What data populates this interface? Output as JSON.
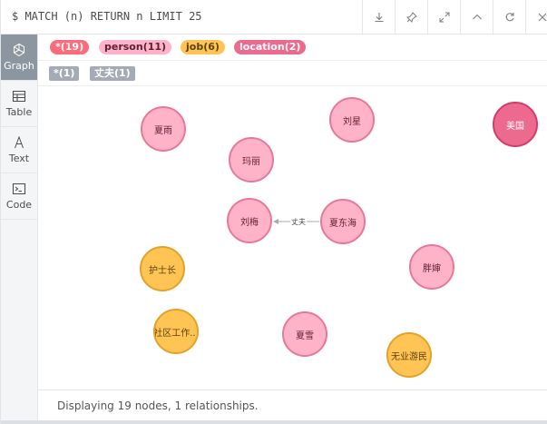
{
  "query": "$ MATCH (n) RETURN n LIMIT 25",
  "toolbar": {
    "icons": [
      "download-icon",
      "pin-icon",
      "expand-icon",
      "collapse-icon",
      "rerun-icon",
      "close-icon"
    ]
  },
  "sidebar": {
    "items": [
      {
        "label": "Graph",
        "icon": "graph-icon",
        "active": true
      },
      {
        "label": "Table",
        "icon": "table-icon",
        "active": false
      },
      {
        "label": "Text",
        "icon": "text-icon",
        "active": false
      },
      {
        "label": "Code",
        "icon": "code-icon",
        "active": false
      }
    ]
  },
  "legend": {
    "labels": [
      {
        "text": "*(19)",
        "color": "#ff6b7a",
        "text_color": "#ffffff"
      },
      {
        "text": "person(11)",
        "color": "#ffb3c8",
        "text_color": "#5f2034"
      },
      {
        "text": "job(6)",
        "color": "#ffc454",
        "text_color": "#5e4210"
      },
      {
        "text": "location(2)",
        "color": "#ed6a8f",
        "text_color": "#ffffff"
      }
    ],
    "relationships": [
      {
        "text": "*(1)"
      },
      {
        "text": "丈夫(1)"
      }
    ]
  },
  "graph": {
    "nodes": [
      {
        "name": "夏雨",
        "type": "person"
      },
      {
        "name": "刘星",
        "type": "person"
      },
      {
        "name": "美国",
        "type": "location"
      },
      {
        "name": "玛丽",
        "type": "person"
      },
      {
        "name": "刘梅",
        "type": "person"
      },
      {
        "name": "夏东海",
        "type": "person"
      },
      {
        "name": "护士长",
        "type": "job"
      },
      {
        "name": "胖婶",
        "type": "person"
      },
      {
        "name": "社区工作...",
        "type": "job"
      },
      {
        "name": "夏雪",
        "type": "person"
      },
      {
        "name": "无业游民",
        "type": "job"
      }
    ],
    "relationship": {
      "label": "丈夫",
      "from": "夏东海",
      "to": "刘梅"
    }
  },
  "status": "Displaying 19 nodes, 1 relationships."
}
